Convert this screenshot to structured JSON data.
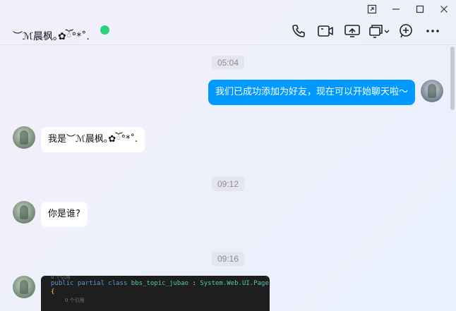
{
  "header": {
    "title": "︶ℳ晨枫｡✿ོ°*˚.",
    "status_color": "#2bd07a",
    "icons": [
      "phone-icon",
      "video-icon",
      "screen-share-icon",
      "remote-assist-icon",
      "add-member-icon",
      "more-icon"
    ]
  },
  "window": {
    "controls": [
      "pin-icon",
      "minimize-icon",
      "maximize-icon",
      "close-icon"
    ]
  },
  "messages": {
    "time1": "05:04",
    "msg1": "我们已成功添加为好友，现在可以开始聊天啦～",
    "msg2": "我是︶ℳ晨枫｡✿ོ°*˚.",
    "time2": "09:12",
    "msg3": "你是谁?",
    "time3": "09:16",
    "code": {
      "ref1": "0 个引用",
      "line_kw": "public partial class",
      "line_cls": "bbs_topic_jubao",
      "line_sep": " : ",
      "line_base": "System.Web.UI.Page",
      "brace": "{",
      "ref2": "0 个引用"
    }
  },
  "colors": {
    "outgoing_bubble": "#0099ff",
    "incoming_bubble": "#ffffff"
  }
}
